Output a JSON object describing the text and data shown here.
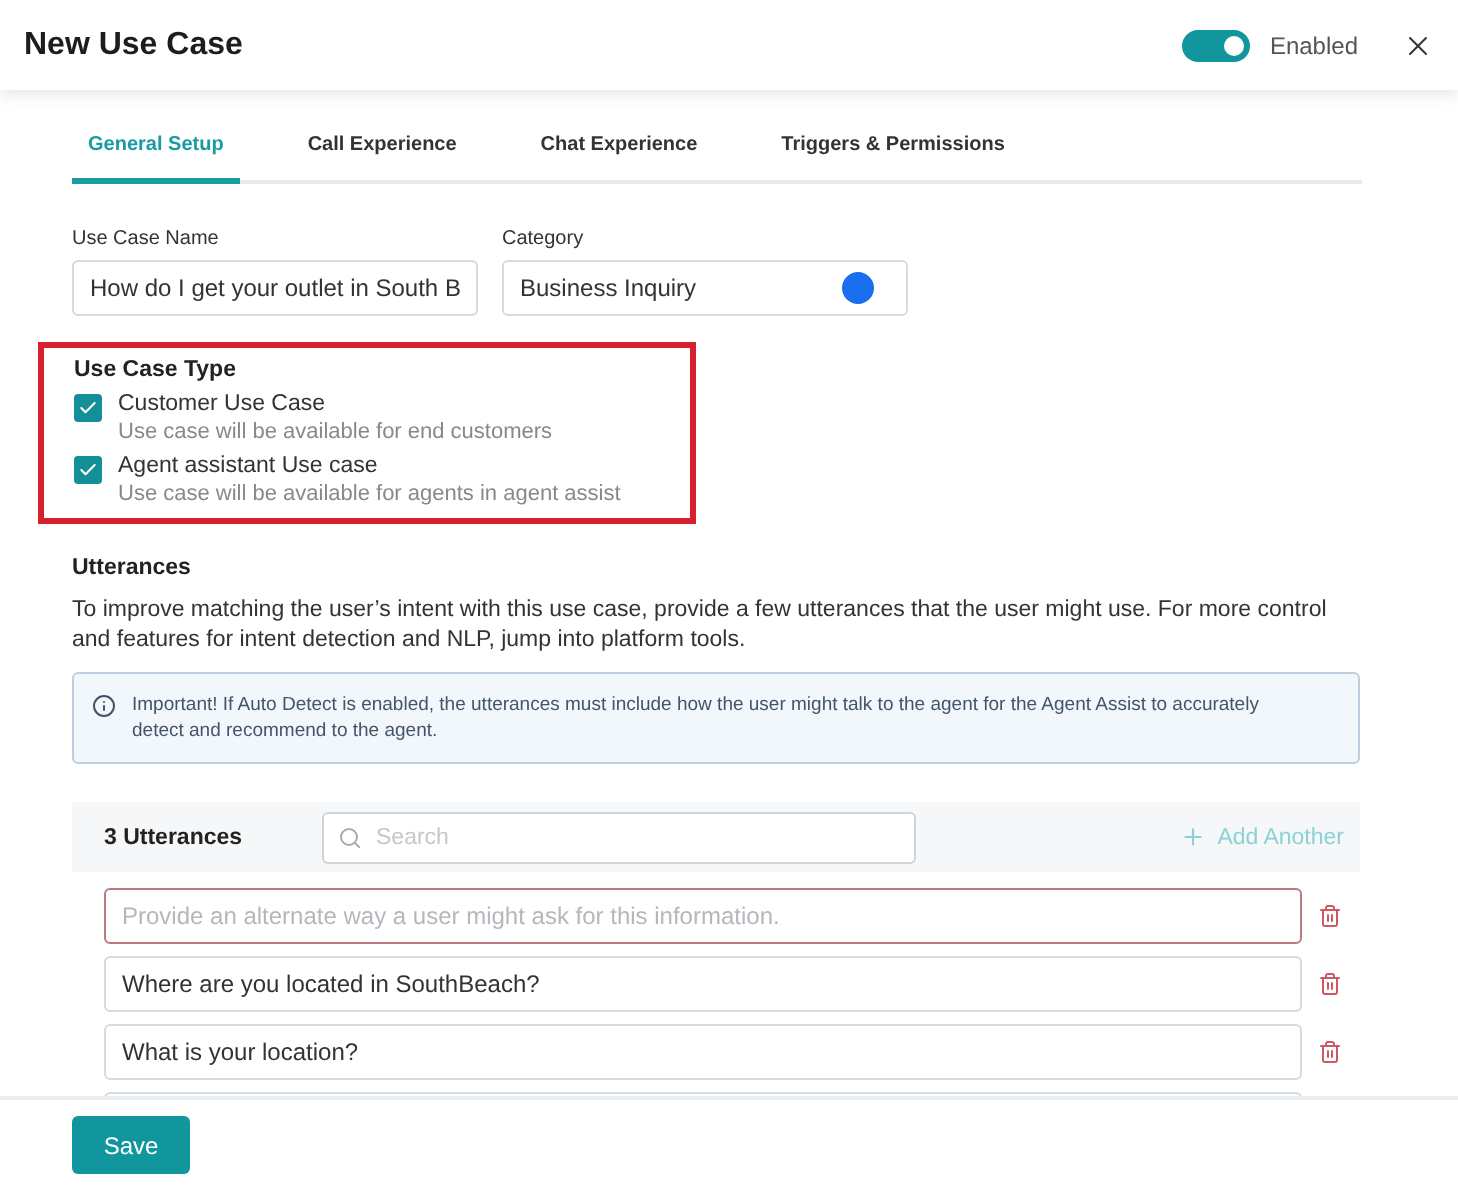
{
  "window": {
    "title": "New Use Case",
    "enabled": {
      "on": true,
      "label": "Enabled"
    }
  },
  "tabs": [
    {
      "label": "General Setup",
      "selected": true
    },
    {
      "label": "Call Experience",
      "selected": false
    },
    {
      "label": "Chat Experience",
      "selected": false
    },
    {
      "label": "Triggers & Permissions",
      "selected": false
    }
  ],
  "name_field": {
    "label": "Use Case Name",
    "value": "How do I get your outlet in South B"
  },
  "category_field": {
    "label": "Category",
    "value": "Business Inquiry",
    "color": "#1a6ff0"
  },
  "use_case_type": {
    "title": "Use Case Type",
    "highlighted": true,
    "options": [
      {
        "label": "Customer Use Case",
        "description": "Use case will be available for end customers",
        "checked": true
      },
      {
        "label": "Agent assistant Use case",
        "description": "Use case will be available for agents in agent assist",
        "checked": true
      }
    ]
  },
  "utterances": {
    "title": "Utterances",
    "description": "To improve matching the user’s intent with this use case, provide a few utterances that the user might use. For more control and features for intent detection and NLP, jump into platform tools.",
    "notice": "Important! If Auto Detect is enabled, the utterances must include how the user might talk to the agent for the Agent Assist to accurately detect and recommend to the agent.",
    "count": "3 Utterances",
    "search": {
      "placeholder": "Search"
    },
    "add_button": "Add Another",
    "items": [
      {
        "placeholder": "Provide an alternate way a user might ask for this information.",
        "focused": true
      },
      {
        "value": "Where are you located in SouthBeach?",
        "focused": false
      },
      {
        "value": "What is your location?",
        "focused": false
      }
    ]
  },
  "footer": {
    "save_button": "Save"
  }
}
